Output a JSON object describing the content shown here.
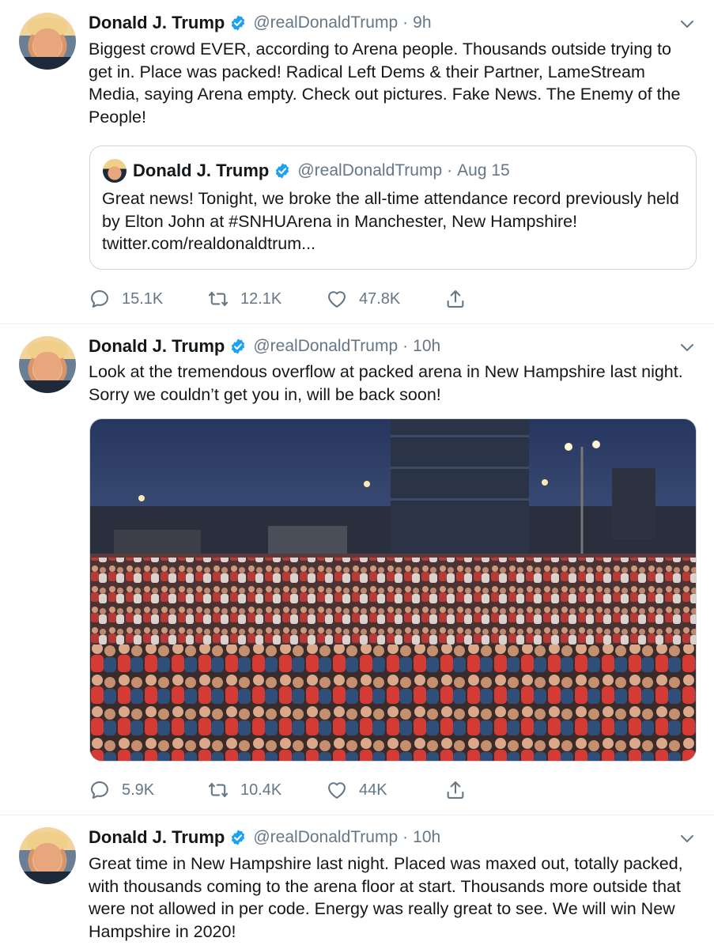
{
  "colors": {
    "text": "#14171a",
    "muted": "#657786",
    "verified": "#1da1f2",
    "divider": "#e6ecf0"
  },
  "tweets": [
    {
      "author": "Donald J. Trump",
      "handle": "@realDonaldTrump",
      "time": "9h",
      "text": "Biggest crowd EVER, according to Arena people. Thousands outside trying to get in. Place was packed! Radical Left Dems & their Partner, LameStream Media, saying Arena empty. Check out pictures. Fake News. The Enemy of the People!",
      "quoted": {
        "author": "Donald J. Trump",
        "handle": "@realDonaldTrump",
        "time": "Aug 15",
        "text": "Great news! Tonight, we broke the all-time attendance record previously held by Elton John at #SNHUArena in Manchester, New Hampshire! twitter.com/realdonaldtrum..."
      },
      "replies": "15.1K",
      "retweets": "12.1K",
      "likes": "47.8K"
    },
    {
      "author": "Donald J. Trump",
      "handle": "@realDonaldTrump",
      "time": "10h",
      "text": "Look at the tremendous overflow at packed arena in New Hampshire last night. Sorry we couldn’t get you in, will be back soon!",
      "replies": "5.9K",
      "retweets": "10.4K",
      "likes": "44K"
    },
    {
      "author": "Donald J. Trump",
      "handle": "@realDonaldTrump",
      "time": "10h",
      "text": "Great time in New Hampshire last night. Placed was maxed out, totally packed, with thousands coming to the arena floor at start. Thousands more outside that were not allowed in per code. Energy was really great to see. We will win New Hampshire in 2020!"
    }
  ],
  "icons": {
    "verified": "verified-badge-icon",
    "caret": "chevron-down-icon",
    "reply": "reply-icon",
    "retweet": "retweet-icon",
    "like": "heart-icon",
    "share": "share-icon"
  }
}
